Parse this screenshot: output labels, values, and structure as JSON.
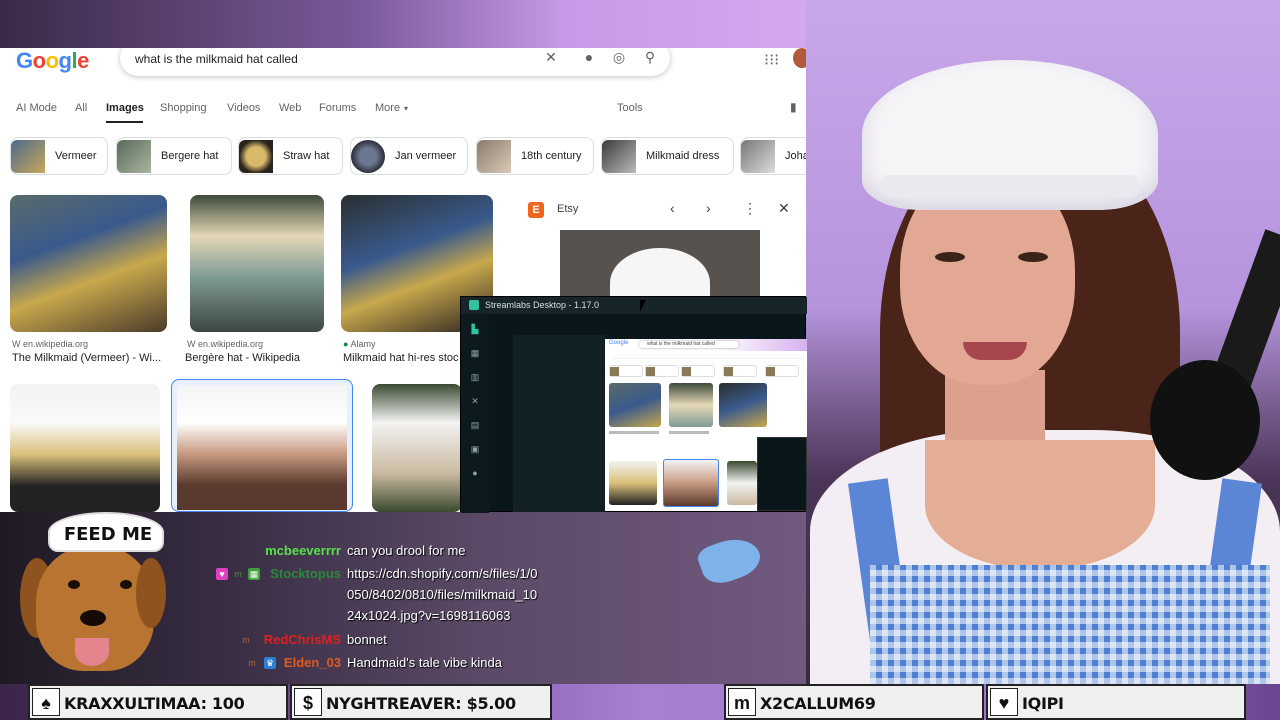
{
  "google": {
    "search_query": "what is the milkmaid hat called",
    "tabs": [
      "AI Mode",
      "All",
      "Images",
      "Shopping",
      "Videos",
      "Web",
      "Forums",
      "More"
    ],
    "tools": "Tools",
    "chips": [
      "Vermeer",
      "Bergere hat",
      "Straw hat",
      "Jan vermeer",
      "18th century",
      "Milkmaid dress",
      "Joha"
    ],
    "results": [
      {
        "source": "en.wikipedia.org",
        "title": "The Milkmaid (Vermeer) - Wi..."
      },
      {
        "source": "en.wikipedia.org",
        "title": "Bergère hat - Wikipedia"
      },
      {
        "source": "Alamy",
        "title": "Milkmaid hat hi-res stoc"
      }
    ],
    "etsy_name": "Etsy"
  },
  "streamlabs": {
    "title": "Streamlabs Desktop - 1.17.0",
    "preview_search": "what is the milkmaid hat called"
  },
  "overlay": {
    "dog_hat_text": "FEED ME"
  },
  "chat": [
    {
      "user": "mcbeeverrrr",
      "user_color": "#56e34a",
      "message": "can you drool for me"
    },
    {
      "user": "Stocktopus",
      "user_color": "#2a8a3a",
      "message": "https://cdn.shopify.com/s/files/1/0"
    },
    {
      "user": "",
      "user_color": "#ffffff",
      "message": "050/8402/0810/files/milkmaid_10"
    },
    {
      "user": "",
      "user_color": "#ffffff",
      "message": "24x1024.jpg?v=1698116063"
    },
    {
      "user": "RedChrisMS",
      "user_color": "#e02020",
      "message": "bonnet"
    },
    {
      "user": "Elden_03",
      "user_color": "#e05a20",
      "message": "Handmaid's tale vibe kinda"
    }
  ],
  "alerts": [
    {
      "icon": "♠",
      "text": "KRAXXULTIMAA: 100"
    },
    {
      "icon": "$",
      "text": "NYGHTREAVER: $5.00"
    },
    {
      "icon": "m",
      "text": "X2CALLUM69"
    },
    {
      "icon": "♥",
      "text": "IQIPI"
    }
  ]
}
